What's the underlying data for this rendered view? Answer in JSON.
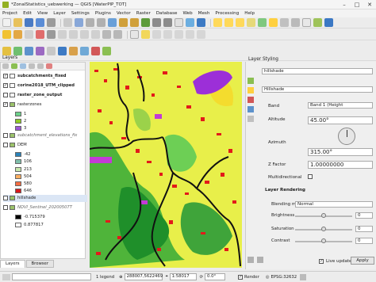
{
  "window": {
    "title": "*ZonalStatistics_uebwerking — QGIS [WaterPlP_TOT]"
  },
  "menu": [
    "Project",
    "Edit",
    "View",
    "Layer",
    "Settings",
    "Plugins",
    "Vector",
    "Raster",
    "Database",
    "Web",
    "Mesh",
    "Processing",
    "Help"
  ],
  "layers_panel": {
    "title": "Layers",
    "layers": [
      {
        "name": "subcatchments_fixed",
        "checked": true,
        "bold": true
      },
      {
        "name": "corine2018_UTM_clipped",
        "checked": true,
        "bold": true
      },
      {
        "name": "raster_zone_output",
        "checked": false,
        "bold": true
      },
      {
        "name": "rasterzones",
        "checked": true,
        "bold": false
      },
      {
        "name": "1",
        "legend": true,
        "color": "#6dd18a"
      },
      {
        "name": "2",
        "legend": true,
        "color": "#8fcc22"
      },
      {
        "name": "3",
        "legend": true,
        "color": "#9b57d6"
      },
      {
        "name": "subcatchment_elevations_fix",
        "checked": false,
        "bold": false,
        "italic": true
      },
      {
        "name": "DEM",
        "checked": false,
        "bold": false
      },
      {
        "name": "-42",
        "legend": true,
        "color": "#2b83ba"
      },
      {
        "name": "106",
        "legend": true,
        "color": "#80bfab"
      },
      {
        "name": "213",
        "legend": true,
        "color": "#c7e8ad"
      },
      {
        "name": "504",
        "legend": true,
        "color": "#fdae61"
      },
      {
        "name": "580",
        "legend": true,
        "color": "#f46d43"
      },
      {
        "name": "646",
        "legend": true,
        "color": "#d7191c"
      },
      {
        "name": "hillshade",
        "checked": false,
        "bold": false,
        "selected": true
      },
      {
        "name": "NDVI_Sentinel_20200507T",
        "checked": false,
        "bold": false,
        "italic": true
      },
      {
        "name": "-0.715379",
        "legend": true,
        "color": "#000000"
      },
      {
        "name": "0.877817",
        "legend": true,
        "color": "#ffffff"
      }
    ],
    "tabs": [
      "Layers",
      "Browser"
    ]
  },
  "style_panel": {
    "title": "Layer Styling",
    "layer": "hillshade",
    "renderer": "Hillshade",
    "band_label": "Band",
    "band_value": "Band 1 (Height",
    "altitude_label": "Altitude",
    "altitude_value": "45.00°",
    "azimuth_label": "Azimuth",
    "azimuth_value": "315.00°",
    "zfactor_label": "Z Factor",
    "zfactor_value": "1.00000000",
    "multidir_label": "Multidirectional",
    "rendering_header": "Layer Rendering",
    "blending_label": "Blending mode",
    "blending_value": "Normal",
    "brightness_label": "Brightness",
    "brightness_value": "0",
    "saturation_label": "Saturation",
    "saturation_value": "0",
    "contrast_label": "Contrast",
    "contrast_value": "0",
    "live_update_label": "Live update",
    "apply_label": "Apply"
  },
  "statusbar": {
    "locate_placeholder": "Type to locate (Ctrl+K)",
    "legend_text": "1 legend",
    "coordinate": "288007,5622469",
    "scale_label": "1:58017",
    "rotation": "0.0°",
    "render_label": "Render",
    "crs": "EPSG:32632"
  }
}
